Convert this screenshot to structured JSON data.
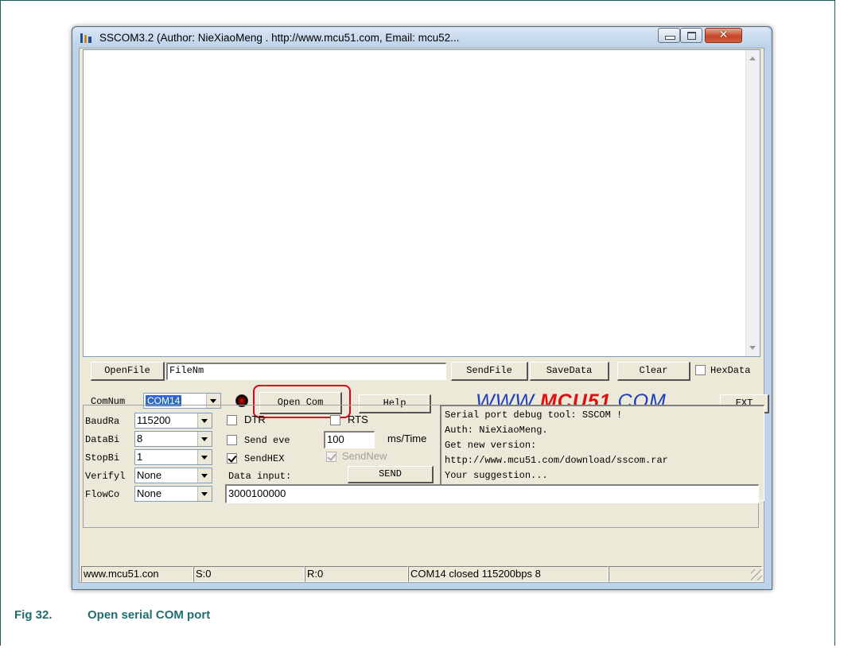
{
  "window": {
    "title": "SSCOM3.2 (Author: NieXiaoMeng . http://www.mcu51.com, Email: mcu52..."
  },
  "toolbar1": {
    "openfile_label": "OpenFile",
    "filename_value": "FileNm",
    "sendfile_label": "SendFile",
    "savedata_label": "SaveData",
    "clear_label": "Clear",
    "hexdata_label": "HexData"
  },
  "toolbar2": {
    "comnum_label": "ComNum",
    "comnum_value": "COM14",
    "open_com_label": "Open Com",
    "help_label": "Help",
    "logo_prefix": "WWW.",
    "logo_brand": "MCU51",
    "logo_suffix": ".COM",
    "ext_label": "EXT"
  },
  "settings": {
    "baudrate_label": "BaudRa",
    "baudrate_value": "115200",
    "databits_label": "DataBi",
    "databits_value": "8",
    "stopbits_label": "StopBi",
    "stopbits_value": "1",
    "verify_label": "Verifyl",
    "verify_value": "None",
    "flowcontrol_label": "FlowCo",
    "flowcontrol_value": "None",
    "dtr_label": "DTR",
    "rts_label": "RTS",
    "send_every_label": "Send eve",
    "interval_value": "100",
    "interval_unit": "ms/Time",
    "sendhex_label": "SendHEX",
    "sendnew_label": "SendNew",
    "data_input_label": "Data input:",
    "send_label": "SEND",
    "data_input_value": "3000100000"
  },
  "info_lines": [
    "Serial port debug tool: SSCOM !",
    "Auth: NieXiaoMeng.",
    "Get new version:",
    "http://www.mcu51.com/download/sscom.rar",
    "Your suggestion..."
  ],
  "status": {
    "site": "www.mcu51.con",
    "sent": "S:0",
    "received": "R:0",
    "port_status": "COM14 closed 115200bps 8"
  },
  "figure_caption": {
    "number": "Fig 32.",
    "text": "Open serial COM port"
  },
  "icons": [
    "app-icon",
    "minimize-icon",
    "maximize-icon",
    "close-icon",
    "port-status-led-icon",
    "dropdown-arrow-icon",
    "resize-grip-icon"
  ],
  "colors": {
    "highlight": "#e0001b",
    "caption": "#1f6f6f",
    "logo_blue": "#1b3fbf",
    "logo_red": "#e01010",
    "selection": "#3168c6"
  }
}
